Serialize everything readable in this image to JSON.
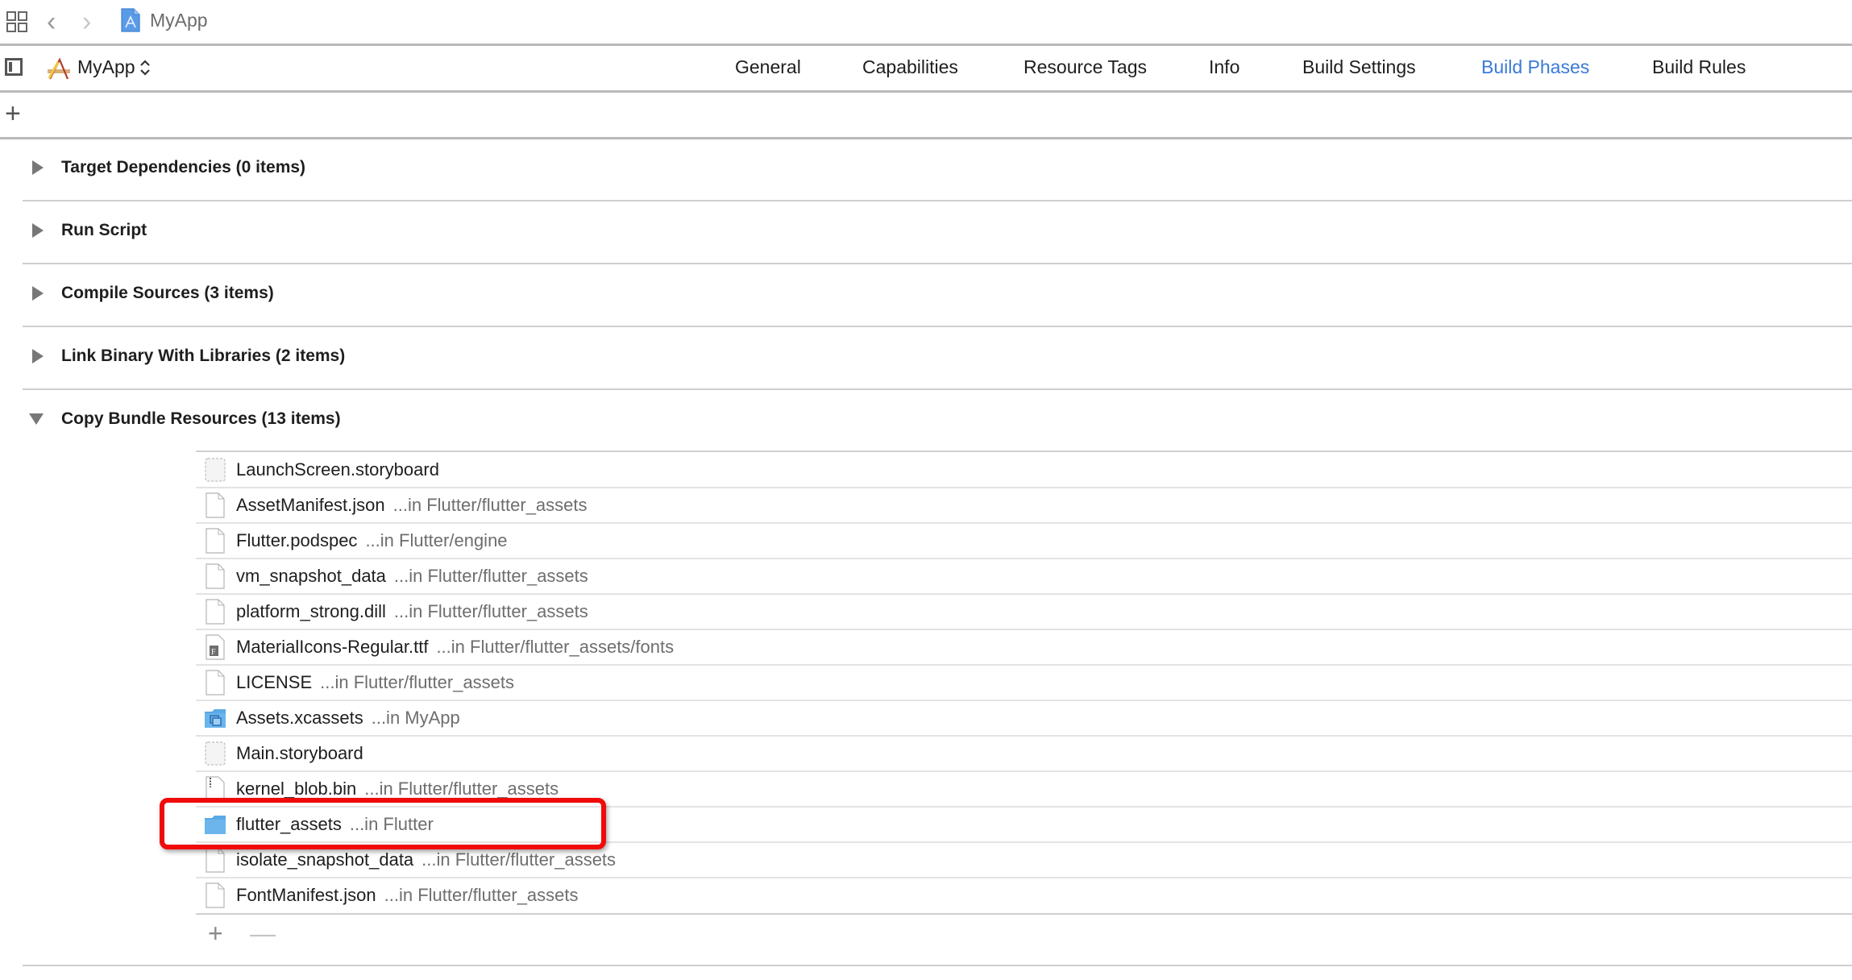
{
  "toolbar": {
    "grid_icon": "related-items-grid-icon",
    "back_icon": "chevron-left-icon",
    "forward_icon": "chevron-right-icon",
    "breadcrumb": {
      "icon": "xcode-project-file-icon",
      "label": "MyApp"
    },
    "back_glyph": "‹",
    "forward_glyph": "›"
  },
  "target_bar": {
    "sidebar_toggle_icon": "sidebar-toggle-icon",
    "target_icon": "app-target-icon",
    "target_name": "MyApp",
    "chevron_glyph": "⌃⌄"
  },
  "tabs": [
    {
      "label": "General",
      "active": false
    },
    {
      "label": "Capabilities",
      "active": false
    },
    {
      "label": "Resource Tags",
      "active": false
    },
    {
      "label": "Info",
      "active": false
    },
    {
      "label": "Build Settings",
      "active": false
    },
    {
      "label": "Build Phases",
      "active": true
    },
    {
      "label": "Build Rules",
      "active": false
    }
  ],
  "add_phase_glyph": "+",
  "phases": [
    {
      "title": "Target Dependencies (0 items)",
      "expanded": false
    },
    {
      "title": "Run Script",
      "expanded": false
    },
    {
      "title": "Compile Sources (3 items)",
      "expanded": false
    },
    {
      "title": "Link Binary With Libraries (2 items)",
      "expanded": false
    },
    {
      "title": "Copy Bundle Resources (13 items)",
      "expanded": true
    }
  ],
  "copy_bundle_resources": [
    {
      "name": "LaunchScreen.storyboard",
      "path": "",
      "icon": "storyboard"
    },
    {
      "name": "AssetManifest.json",
      "path": "...in Flutter/flutter_assets",
      "icon": "document"
    },
    {
      "name": "Flutter.podspec",
      "path": "...in Flutter/engine",
      "icon": "document"
    },
    {
      "name": "vm_snapshot_data",
      "path": "...in Flutter/flutter_assets",
      "icon": "document"
    },
    {
      "name": "platform_strong.dill",
      "path": "...in Flutter/flutter_assets",
      "icon": "document"
    },
    {
      "name": "MaterialIcons-Regular.ttf",
      "path": "...in Flutter/flutter_assets/fonts",
      "icon": "font"
    },
    {
      "name": "LICENSE",
      "path": "...in Flutter/flutter_assets",
      "icon": "document"
    },
    {
      "name": "Assets.xcassets",
      "path": "...in MyApp",
      "icon": "asset-catalog"
    },
    {
      "name": "Main.storyboard",
      "path": "",
      "icon": "storyboard"
    },
    {
      "name": "kernel_blob.bin",
      "path": "...in Flutter/flutter_assets",
      "icon": "binary"
    },
    {
      "name": "flutter_assets",
      "path": "...in Flutter",
      "icon": "folder"
    },
    {
      "name": "isolate_snapshot_data",
      "path": "...in Flutter/flutter_assets",
      "icon": "document"
    },
    {
      "name": "FontManifest.json",
      "path": "...in Flutter/flutter_assets",
      "icon": "document"
    }
  ],
  "list_controls": {
    "add_glyph": "+",
    "remove_glyph": "—"
  },
  "highlight": {
    "target": "flutter_assets",
    "color": "#f00a0a"
  },
  "colors": {
    "accent": "#3a7ad8",
    "divider": "#b9b9b9",
    "folder": "#6bb5ec"
  }
}
